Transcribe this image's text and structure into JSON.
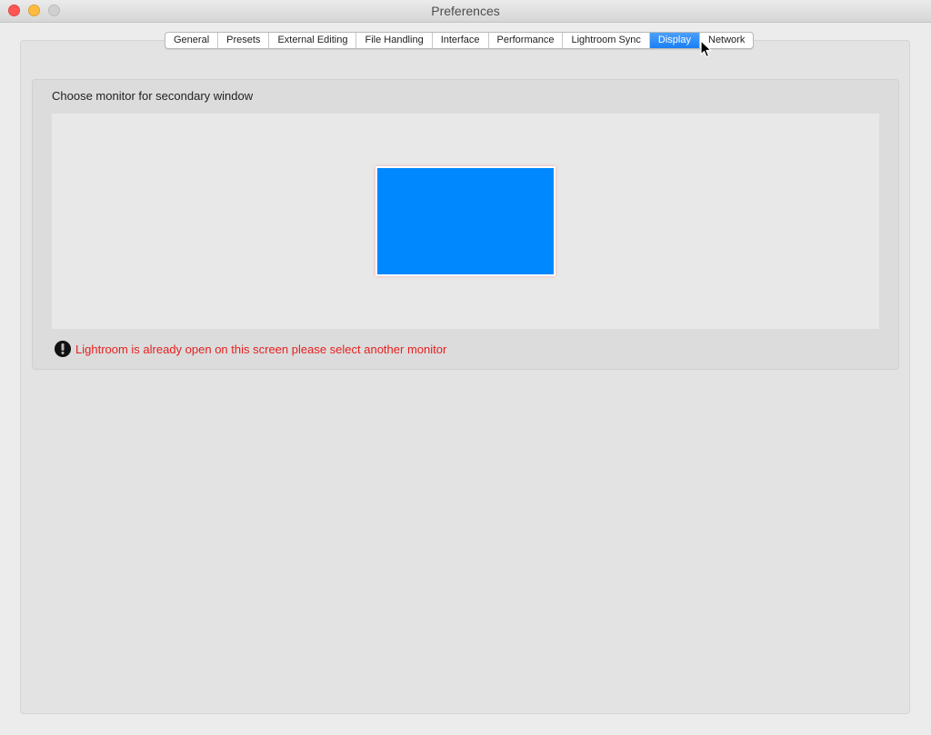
{
  "window": {
    "title": "Preferences"
  },
  "tabs": [
    {
      "label": "General"
    },
    {
      "label": "Presets"
    },
    {
      "label": "External Editing"
    },
    {
      "label": "File Handling"
    },
    {
      "label": "Interface"
    },
    {
      "label": "Performance"
    },
    {
      "label": "Lightroom Sync"
    },
    {
      "label": "Display",
      "active": true
    },
    {
      "label": "Network"
    }
  ],
  "display": {
    "group_label": "Choose monitor for secondary window",
    "warning": "Lightroom is already open on this screen please select another monitor",
    "monitor_color": "#0088ff",
    "warning_color": "#e62020"
  },
  "icons": {
    "warning": "exclamation-icon",
    "cursor": "mouse-pointer-icon"
  }
}
